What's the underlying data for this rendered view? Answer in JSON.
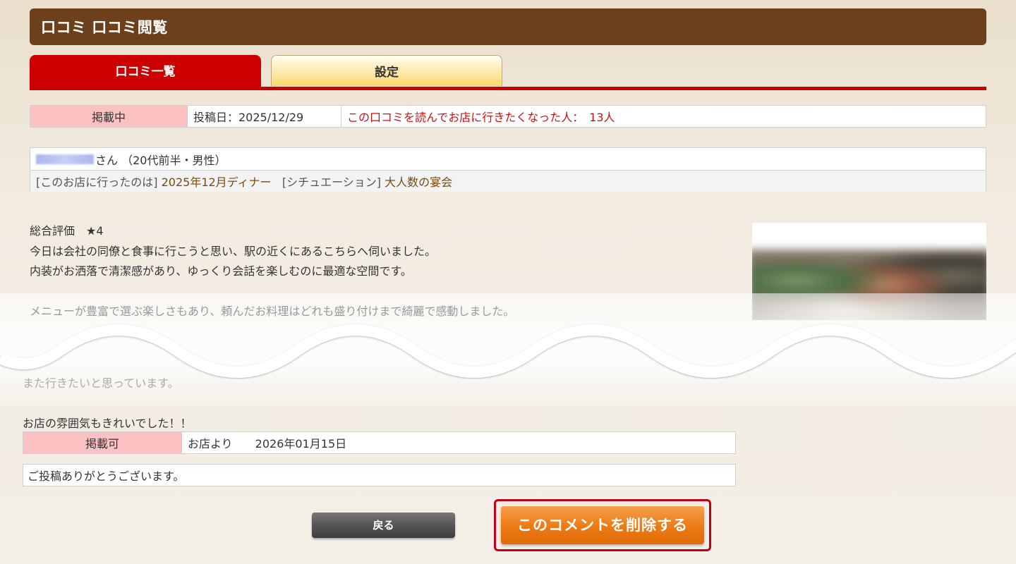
{
  "header": {
    "title": "口コミ 口コミ閲覧"
  },
  "tabs": [
    {
      "label": "口コミ一覧",
      "active": true
    },
    {
      "label": "設定",
      "active": false
    }
  ],
  "status_row": {
    "status": "掲載中",
    "post_date": "投稿日：2025/12/29",
    "wanted_to_visit": "この口コミを読んでお店に行きたくなった人：　13人"
  },
  "reviewer": {
    "name_suffix": "さん （20代前半・男性）",
    "visit_prefix": "[このお店に行ったのは]",
    "visit_value": "2025年12月ディナー",
    "situation_prefix": "[シチュエーション]",
    "situation_value": "大人数の宴会"
  },
  "review": {
    "rating": "総合評価　★4",
    "lines": [
      "今日は会社の同僚と食事に行こうと思い、駅の近くにあるこちらへ伺いました。",
      "内装がお洒落で清潔感があり、ゆっくり会話を楽しむのに最適な空間です。"
    ],
    "faded_line": "メニューが豊富で選ぶ楽しさもあり、頼んだお料理はどれも盛り付けまで綺麗で感動しました。",
    "faded_line2": "また行きたいと思っています。",
    "closing": "お店の雰囲気もきれいでした！！"
  },
  "reply": {
    "status": "掲載可",
    "from": "お店より　　2026年01月15日",
    "message": "ご投稿ありがとうございます。"
  },
  "buttons": {
    "back": "戻る",
    "delete": "このコメントを削除する"
  },
  "colors": {
    "header_bg": "#6b401b",
    "tab_active": "#cc0000",
    "status_pink": "#fcc1c3",
    "delete_orange": "#ec7a14",
    "delete_frame": "#c00016"
  }
}
